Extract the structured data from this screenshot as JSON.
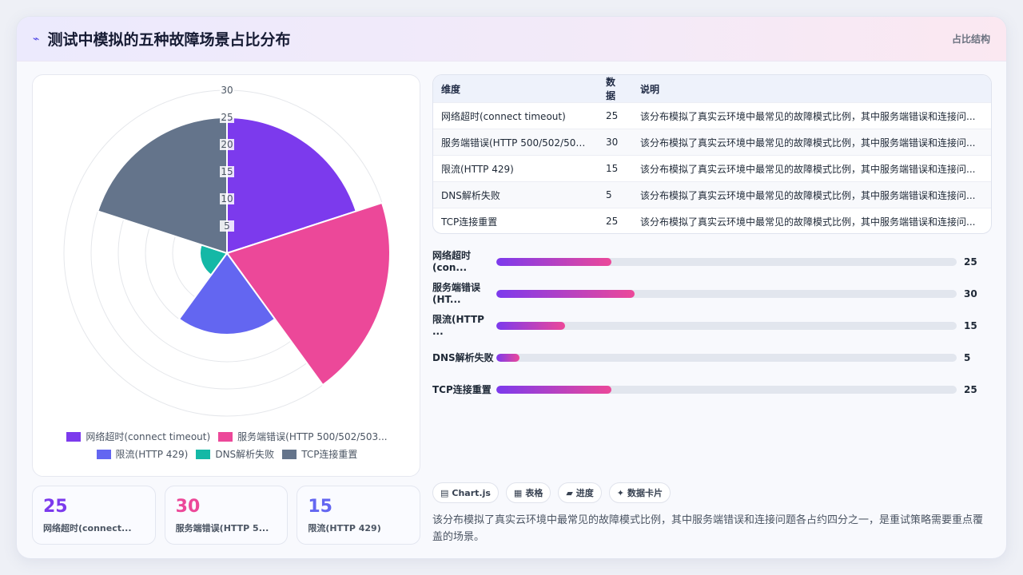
{
  "header": {
    "title": "测试中模拟的五种故障场景占比分布",
    "tag": "占比结构"
  },
  "chart_data": {
    "type": "polarArea",
    "title": "",
    "categories": [
      "网络超时(connect timeout)",
      "服务端错误(HTTP 500/502/503...",
      "限流(HTTP 429)",
      "DNS解析失败",
      "TCP连接重置"
    ],
    "values": [
      25,
      30,
      15,
      5,
      25
    ],
    "colors": [
      "#7c3aed",
      "#ec4899",
      "#6366f1",
      "#14b8a6",
      "#64748b"
    ],
    "r_ticks": [
      "5",
      "10",
      "15",
      "20",
      "25",
      "30"
    ],
    "rlim": [
      0,
      30
    ],
    "legend_position": "bottom",
    "grid": true
  },
  "table": {
    "headers": [
      "维度",
      "数据",
      "说明"
    ],
    "rows": [
      {
        "name": "网络超时(connect timeout)",
        "value": "25",
        "note": "该分布模拟了真实云环境中最常见的故障模式比例，其中服务端错误和连接问..."
      },
      {
        "name": "服务端错误(HTTP 500/502/503...",
        "value": "30",
        "note": "该分布模拟了真实云环境中最常见的故障模式比例，其中服务端错误和连接问..."
      },
      {
        "name": "限流(HTTP 429)",
        "value": "15",
        "note": "该分布模拟了真实云环境中最常见的故障模式比例，其中服务端错误和连接问..."
      },
      {
        "name": "DNS解析失败",
        "value": "5",
        "note": "该分布模拟了真实云环境中最常见的故障模式比例，其中服务端错误和连接问..."
      },
      {
        "name": "TCP连接重置",
        "value": "25",
        "note": "该分布模拟了真实云环境中最常见的故障模式比例，其中服务端错误和连接问..."
      }
    ]
  },
  "bars": {
    "max": 100,
    "items": [
      {
        "label": "网络超时(con...",
        "value": 25,
        "display": "25"
      },
      {
        "label": "服务端错误(HT...",
        "value": 30,
        "display": "30"
      },
      {
        "label": "限流(HTTP ...",
        "value": 15,
        "display": "15"
      },
      {
        "label": "DNS解析失败",
        "value": 5,
        "display": "5"
      },
      {
        "label": "TCP连接重置",
        "value": 25,
        "display": "25"
      }
    ]
  },
  "kpis": [
    {
      "value": "25",
      "label": "网络超时(connect...",
      "color": "#7c3aed"
    },
    {
      "value": "30",
      "label": "服务端错误(HTTP 5...",
      "color": "#ec4899"
    },
    {
      "value": "15",
      "label": "限流(HTTP 429)",
      "color": "#6366f1"
    }
  ],
  "chips": [
    {
      "icon": "▤",
      "label": "Chart.js"
    },
    {
      "icon": "▦",
      "label": "表格"
    },
    {
      "icon": "▰",
      "label": "进度"
    },
    {
      "icon": "✦",
      "label": "数据卡片"
    }
  ],
  "description": "该分布模拟了真实云环境中最常见的故障模式比例，其中服务端错误和连接问题各占约四分之一，是重试策略需要重点覆盖的场景。"
}
